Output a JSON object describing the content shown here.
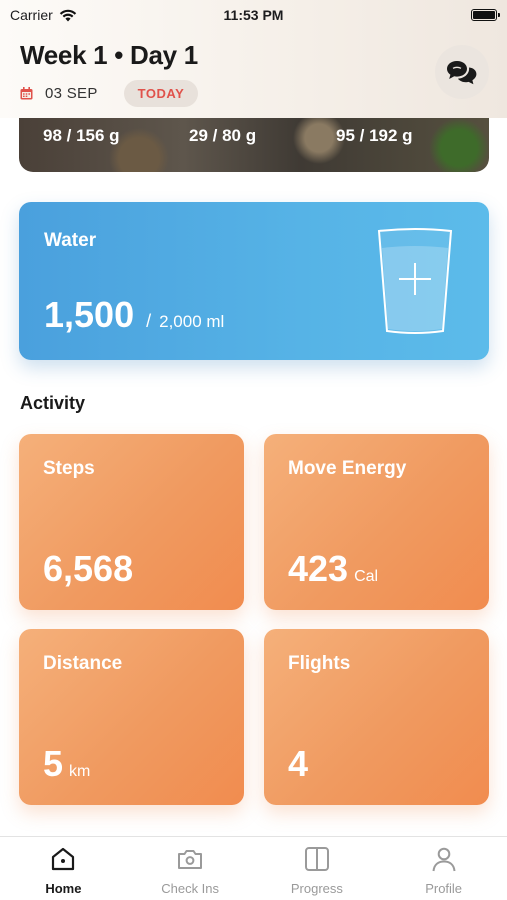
{
  "status_bar": {
    "carrier": "Carrier",
    "time": "11:53 PM"
  },
  "header": {
    "title": "Week 1 • Day 1",
    "date": "03 SEP",
    "today_label": "TODAY",
    "chat_icon": "chat-bubbles-icon"
  },
  "macros": {
    "values": [
      "98 / 156 g",
      "29 / 80 g",
      "95 / 192 g"
    ]
  },
  "water": {
    "label": "Water",
    "amount": "1,500",
    "separator": "/",
    "goal": "2,000 ml",
    "icon": "water-glass-add-icon",
    "color": "#52aee4"
  },
  "activity": {
    "title": "Activity",
    "tiles": [
      {
        "label": "Steps",
        "value": "6,568",
        "unit": ""
      },
      {
        "label": "Move Energy",
        "value": "423",
        "unit": "Cal"
      },
      {
        "label": "Distance",
        "value": "5",
        "unit": "km"
      },
      {
        "label": "Flights",
        "value": "4",
        "unit": ""
      }
    ],
    "color": "#f2a064"
  },
  "tabs": [
    {
      "label": "Home",
      "icon": "home-icon",
      "active": true
    },
    {
      "label": "Check Ins",
      "icon": "camera-icon",
      "active": false
    },
    {
      "label": "Progress",
      "icon": "progress-book-icon",
      "active": false
    },
    {
      "label": "Profile",
      "icon": "person-icon",
      "active": false
    }
  ]
}
